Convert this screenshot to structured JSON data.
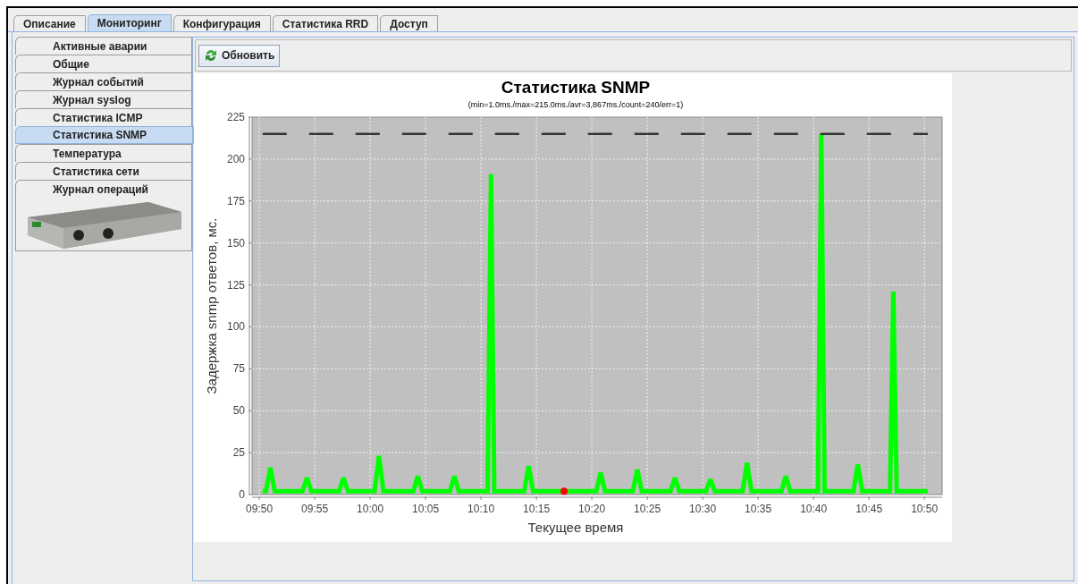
{
  "tabs": [
    {
      "label": "Описание",
      "selected": false
    },
    {
      "label": "Мониторинг",
      "selected": true
    },
    {
      "label": "Конфигурация",
      "selected": false
    },
    {
      "label": "Статистика RRD",
      "selected": false
    },
    {
      "label": "Доступ",
      "selected": false
    }
  ],
  "sidebar": {
    "items": [
      {
        "label": "Активные аварии",
        "selected": false
      },
      {
        "label": "Общие",
        "selected": false
      },
      {
        "label": "Журнал событий",
        "selected": false
      },
      {
        "label": "Журнал syslog",
        "selected": false
      },
      {
        "label": "Статистика ICMP",
        "selected": false
      },
      {
        "label": "Статистика SNMP",
        "selected": true
      },
      {
        "label": "Температура",
        "selected": false
      },
      {
        "label": "Статистика сети",
        "selected": false
      },
      {
        "label": "Журнал операций",
        "selected": false
      }
    ]
  },
  "toolbar": {
    "refresh_button": "Обновить"
  },
  "chart": {
    "chart_data": {
      "type": "line",
      "title": "Статистика SNMP",
      "subtitle": "(min=1.0ms./max=215.0ms./avr=3,867ms./count=240/err=1)",
      "xlabel": "Текущее время",
      "ylabel": "Задержка snmp ответов, мс.",
      "grid": true,
      "xlim": [
        589.35,
        651.6
      ],
      "ylim": [
        0,
        225
      ],
      "yticks": [
        0,
        25,
        50,
        75,
        100,
        125,
        150,
        175,
        200,
        225
      ],
      "xticks": [
        {
          "value": 590,
          "label": "09:50"
        },
        {
          "value": 595,
          "label": "09:55"
        },
        {
          "value": 600,
          "label": "10:00"
        },
        {
          "value": 605,
          "label": "10:05"
        },
        {
          "value": 610,
          "label": "10:10"
        },
        {
          "value": 615,
          "label": "10:15"
        },
        {
          "value": 620,
          "label": "10:20"
        },
        {
          "value": 625,
          "label": "10:25"
        },
        {
          "value": 630,
          "label": "10:30"
        },
        {
          "value": 635,
          "label": "10:35"
        },
        {
          "value": 640,
          "label": "10:40"
        },
        {
          "value": 645,
          "label": "10:45"
        },
        {
          "value": 650,
          "label": "10:50"
        }
      ],
      "x": [
        590.3,
        590.6,
        591.0,
        591.4,
        593.9,
        594.3,
        594.7,
        597.2,
        597.6,
        598.0,
        600.4,
        600.8,
        601.2,
        603.9,
        604.3,
        604.7,
        607.2,
        607.6,
        608.0,
        610.6,
        610.9,
        611.2,
        613.9,
        614.3,
        614.7,
        617.5,
        620.4,
        620.8,
        621.2,
        623.7,
        624.1,
        624.5,
        627.1,
        627.5,
        627.9,
        630.3,
        630.7,
        631.1,
        633.6,
        634.0,
        634.4,
        637.1,
        637.5,
        637.9,
        640.4,
        640.7,
        641.0,
        643.6,
        644.0,
        644.4,
        646.9,
        647.2,
        647.5,
        650.3
      ],
      "series": [
        {
          "color": "#00ff00",
          "values": [
            2,
            2,
            16,
            2,
            2,
            10,
            2,
            2,
            10,
            2,
            2,
            23,
            2,
            2,
            11,
            2,
            2,
            11,
            2,
            2,
            191,
            2,
            2,
            17,
            2,
            2,
            2,
            13,
            2,
            2,
            15,
            2,
            2,
            10,
            2,
            2,
            9,
            2,
            2,
            19,
            2,
            2,
            11,
            2,
            2,
            215,
            2,
            2,
            18,
            2,
            2,
            121,
            2,
            2
          ]
        },
        {
          "color": "#ff0000",
          "marker": "circle",
          "values": [
            null,
            null,
            null,
            null,
            null,
            null,
            null,
            null,
            null,
            null,
            null,
            null,
            null,
            null,
            null,
            null,
            null,
            null,
            null,
            null,
            null,
            null,
            null,
            null,
            null,
            2,
            null,
            null,
            null,
            null,
            null,
            null,
            null,
            null,
            null,
            null,
            null,
            null,
            null,
            null,
            null,
            null,
            null,
            null,
            null,
            null,
            null,
            null,
            null,
            null,
            null,
            null,
            null,
            null
          ]
        },
        {
          "color": "#333333",
          "line_style": "dashed",
          "values": [
            215,
            null,
            null,
            null,
            null,
            null,
            null,
            null,
            null,
            null,
            null,
            null,
            null,
            null,
            null,
            null,
            null,
            null,
            null,
            null,
            null,
            null,
            null,
            null,
            null,
            null,
            null,
            null,
            null,
            null,
            null,
            null,
            null,
            null,
            null,
            null,
            null,
            null,
            null,
            null,
            null,
            null,
            null,
            null,
            null,
            null,
            null,
            null,
            null,
            null,
            null,
            null,
            null,
            215
          ]
        }
      ]
    }
  }
}
